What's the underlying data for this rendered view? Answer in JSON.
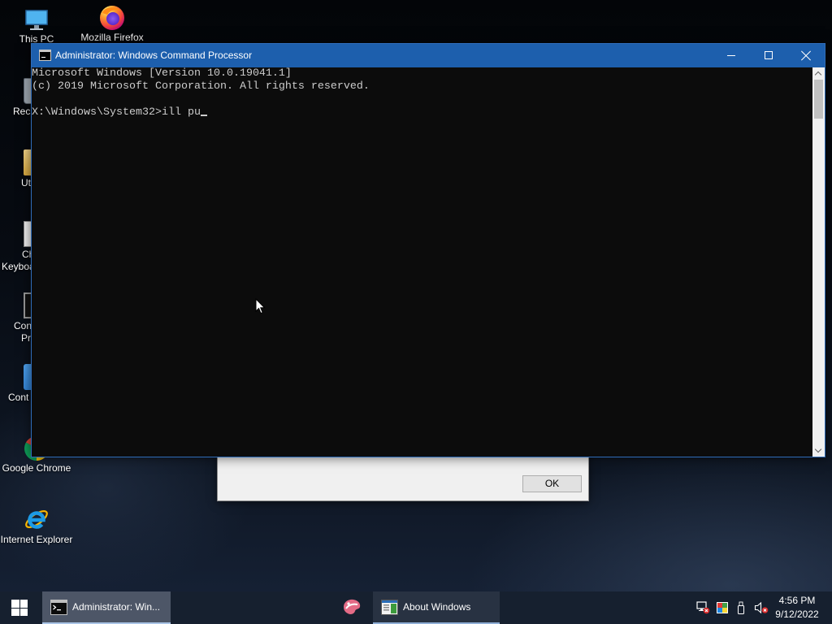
{
  "desktop": {
    "icons": [
      {
        "label": "This PC",
        "icon": "this-pc-icon"
      },
      {
        "label": "Mozilla Firefox",
        "icon": "firefox-icon"
      },
      {
        "label": "Google Chrome",
        "icon": "chrome-icon"
      },
      {
        "label": "Internet Explorer",
        "icon": "internet-explorer-icon"
      }
    ],
    "obscured_icons": [
      {
        "lines": [
          "Rec"
        ],
        "icon": "recycle-bin-icon"
      },
      {
        "lines": [
          "Ut"
        ],
        "icon": "folder-icon"
      },
      {
        "lines": [
          "Ch",
          "Keyboa"
        ],
        "icon": "keyboard-icon"
      },
      {
        "lines": [
          "Con",
          "Pr"
        ],
        "icon": "command-prompt-icon"
      },
      {
        "lines": [
          "Cont"
        ],
        "icon": "control-panel-icon"
      }
    ]
  },
  "cmd_window": {
    "title": "Administrator: Windows Command Processor",
    "title_icon": "command-prompt-icon",
    "output": [
      "Microsoft Windows [Version 10.0.19041.1]",
      "(c) 2019 Microsoft Corporation. All rights reserved.",
      ""
    ],
    "prompt": "X:\\Windows\\System32>",
    "input": "ill pu",
    "buttons": {
      "minimize": "minimize-icon",
      "maximize": "maximize-icon",
      "close": "close-icon"
    }
  },
  "about_dialog": {
    "ok_label": "OK"
  },
  "taskbar": {
    "start_icon": "windows-logo-icon",
    "tasks": [
      {
        "label": "Administrator: Win...",
        "icon": "command-prompt-icon",
        "active": true
      },
      {
        "label": "About Windows",
        "icon": "about-windows-icon",
        "active": false
      }
    ],
    "pinned": [
      {
        "icon": "pinned-app-icon"
      }
    ],
    "tray": [
      "network-disconnected-icon",
      "color-icon",
      "removable-device-icon",
      "volume-muted-icon"
    ],
    "clock": {
      "time": "4:56 PM",
      "date": "9/12/2022"
    }
  },
  "colors": {
    "title_bar": "#1d5fad",
    "console_background": "#0c0c0c",
    "console_text": "#cccccc",
    "taskbar": "#16202f",
    "active_task": "#4d5667"
  }
}
